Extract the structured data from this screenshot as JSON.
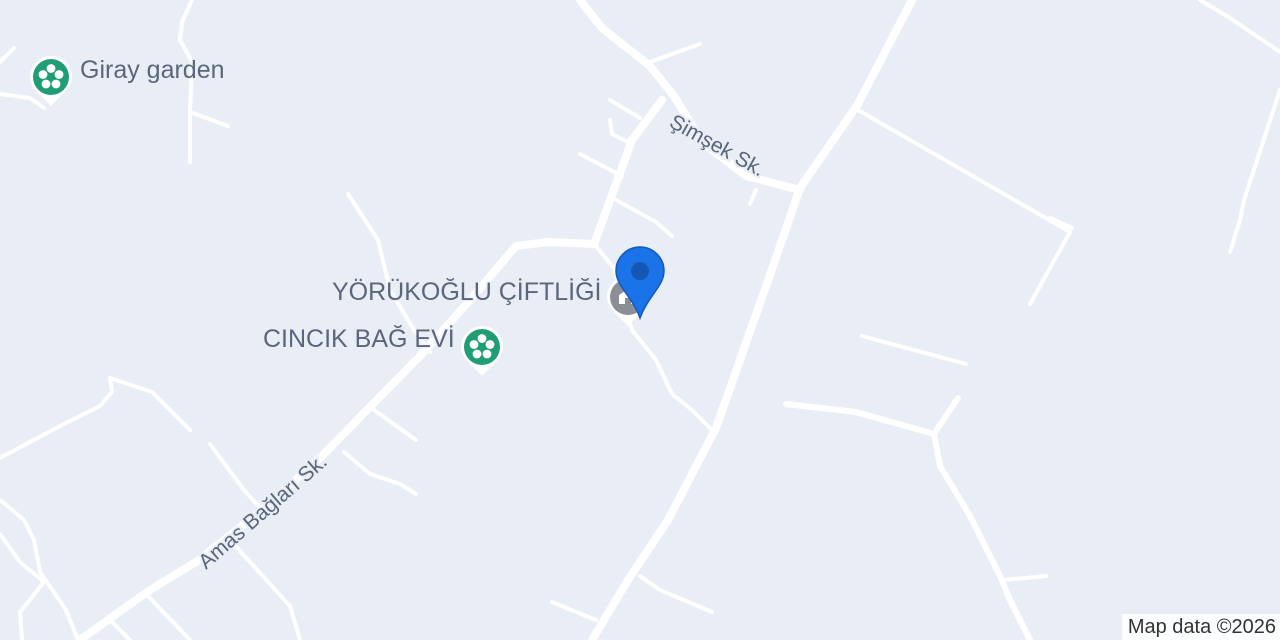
{
  "map": {
    "streets": [
      {
        "name": "Şimşek Sk."
      },
      {
        "name": "Amas Bağları Sk."
      }
    ],
    "pois": [
      {
        "name": "Giray garden",
        "icon": "flower-icon",
        "color": "#1f9d74"
      },
      {
        "name": "CINCIK BAĞ EVİ",
        "icon": "flower-icon",
        "color": "#1f9d74"
      },
      {
        "name": "YÖRÜKOĞLU ÇİFTLİĞİ",
        "icon": "farm-icon",
        "color": "#8a8f96"
      }
    ],
    "marker": {
      "icon": "location-pin-icon",
      "color": "#1a73e8"
    },
    "attribution": "Map data ©2026"
  }
}
